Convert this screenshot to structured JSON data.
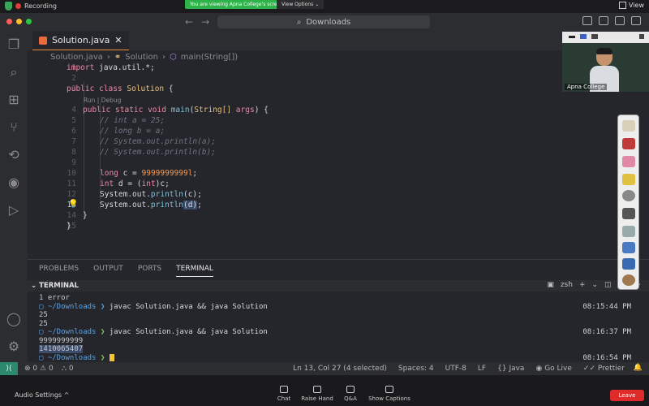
{
  "zoom_top": {
    "recording_label": "Recording",
    "viewing_label": "You are viewing Apna College's screen",
    "view_options_label": "View Options",
    "view_label": "View"
  },
  "titlebar": {
    "search_text": "Downloads"
  },
  "editor": {
    "tab_label": "Solution.java",
    "breadcrumb": {
      "file": "Solution.java",
      "class": "Solution",
      "method": "main(String[])"
    },
    "codelens": "Run | Debug",
    "line_numbers": [
      "1",
      "2",
      "3",
      "4",
      "5",
      "6",
      "7",
      "8",
      "9",
      "10",
      "11",
      "12",
      "13",
      "14",
      "15"
    ],
    "code": {
      "l1_kw": "import",
      "l1_rest": " java.util.*;",
      "l3_kw": "public class",
      "l3_cls": "Solution",
      "l3_rest": " {",
      "l4_kw": "public static void",
      "l4_fn": "main",
      "l4_open": "(",
      "l4_ty": "String[]",
      "l4_arg": " args",
      "l4_close": ") {",
      "l5": "// int a = 25;",
      "l6": "// long b = a;",
      "l7": "// System.out.println(a);",
      "l8": "// System.out.println(b);",
      "l10_kw": "long",
      "l10_id": " c = ",
      "l10_num": "9999999999l",
      "l10_end": ";",
      "l11_kw": "int",
      "l11_id": " d = (",
      "l11_kw2": "int",
      "l11_end": ")c;",
      "l12_pre": "System.out.",
      "l12_fn": "println",
      "l12_end": "(c);",
      "l13_pre": "System.out.",
      "l13_fn": "println",
      "l13_sel": "(d)",
      "l13_end": ";",
      "l14": "}",
      "l15": "}"
    }
  },
  "panel": {
    "tabs": [
      "PROBLEMS",
      "OUTPUT",
      "PORTS",
      "TERMINAL"
    ],
    "terminal_title": "TERMINAL",
    "shell_label": "zsh",
    "lines": {
      "t1": "1 error",
      "t2_dir": "~/Downloads",
      "t2_cmd": "javac Solution.java && java Solution",
      "t2_time": "08:15:44 PM",
      "t3": "25",
      "t4": "25",
      "t5_dir": "~/Downloads",
      "t5_cmd": "javac Solution.java && java Solution",
      "t5_time": "08:16:37 PM",
      "t6": "9999999999",
      "t7": "1410065407",
      "t8_dir": "~/Downloads",
      "t8_time": "08:16:54 PM"
    }
  },
  "status": {
    "errors": "0",
    "warnings": "0",
    "ports": "0",
    "position": "Ln 13, Col 27 (4 selected)",
    "spaces": "Spaces: 4",
    "encoding": "UTF-8",
    "eol": "LF",
    "language": "Java",
    "golive": "Go Live",
    "prettier": "Prettier"
  },
  "zoom_bottom": {
    "audio_settings": "Audio Settings",
    "chat": "Chat",
    "raise_hand": "Raise Hand",
    "qa": "Q&A",
    "captions": "Show Captions",
    "leave": "Leave"
  },
  "webcam": {
    "name": "Apna College"
  },
  "colors": {
    "accent": "#ee8a3c",
    "leave": "#e02b2b",
    "viewing_banner": "#2db34a"
  }
}
